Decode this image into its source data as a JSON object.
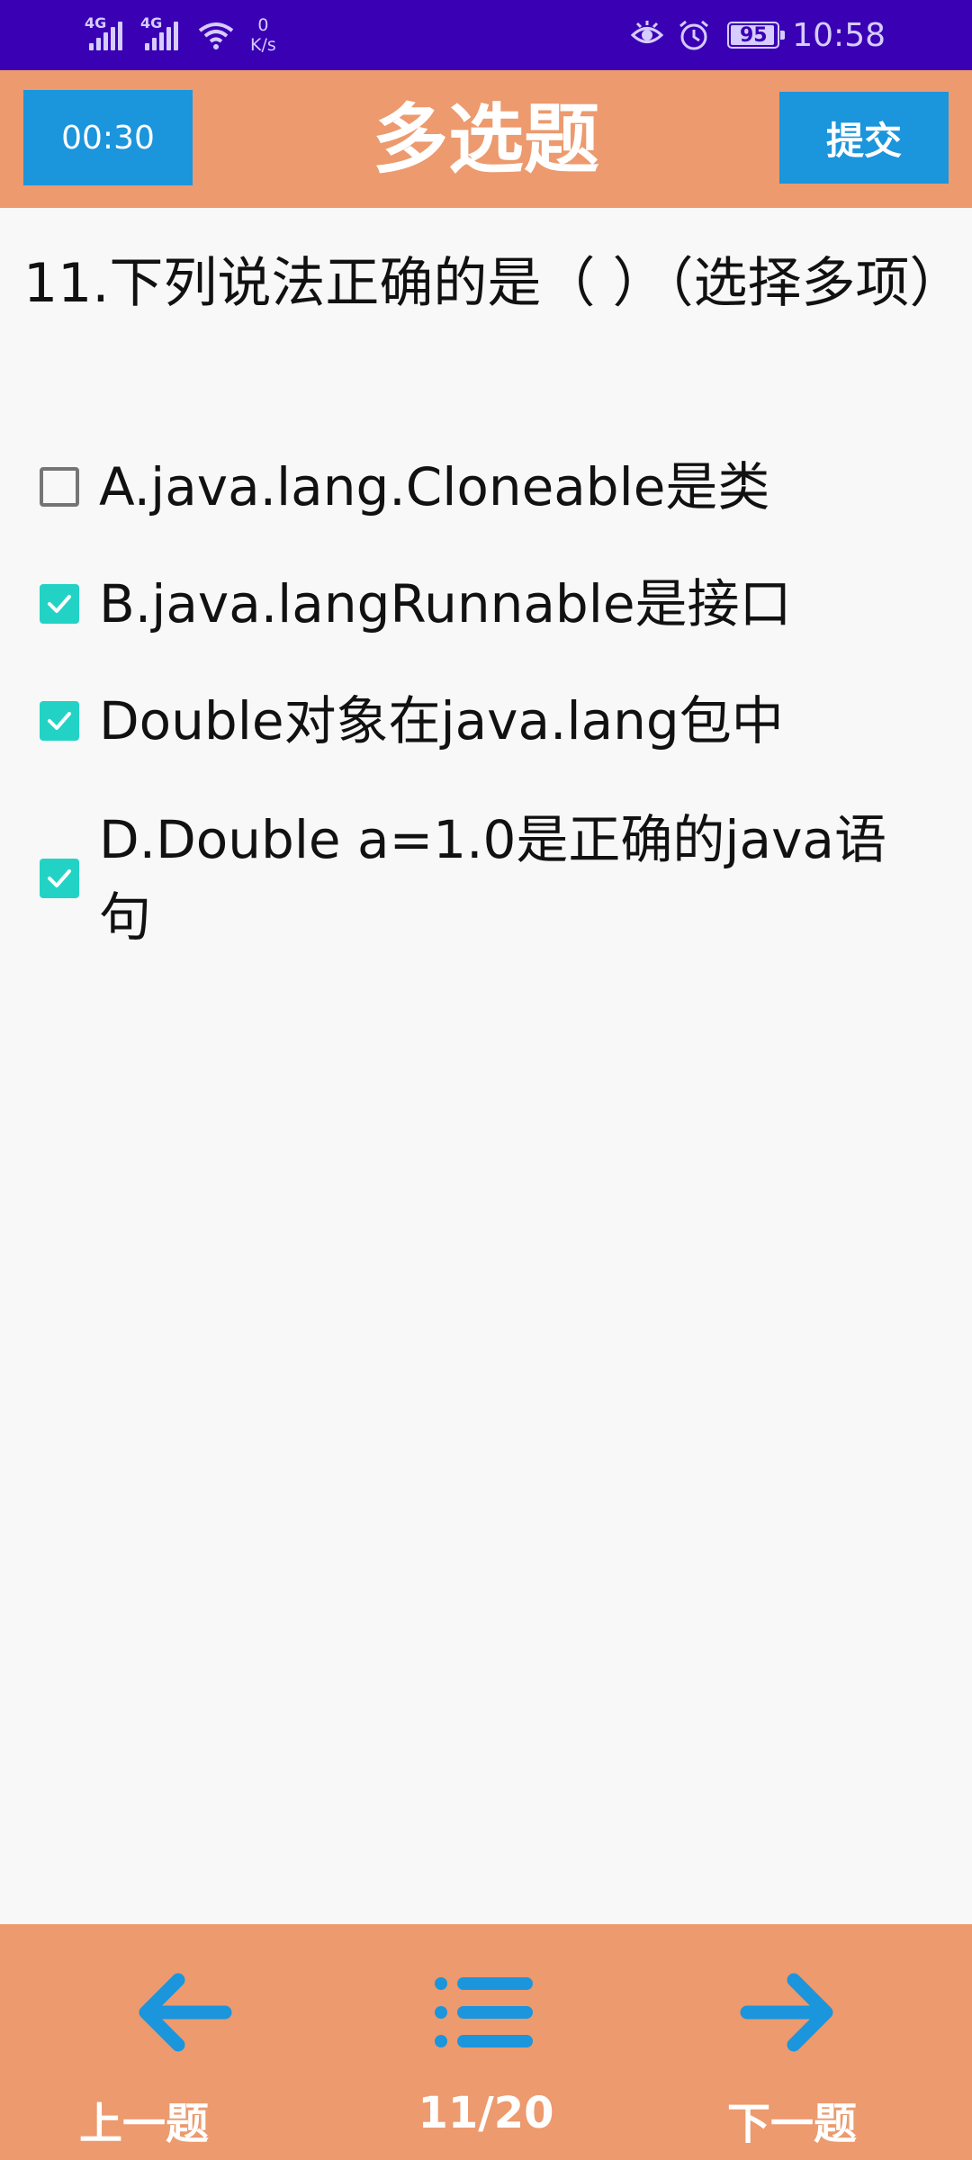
{
  "status_bar": {
    "signal_1_label": "4G",
    "signal_2_label": "4G",
    "net_speed_value": "0",
    "net_speed_unit": "K/s",
    "battery_level": "95",
    "time": "10:58"
  },
  "header": {
    "timer": "00:30",
    "title": "多选题",
    "submit_label": "提交"
  },
  "question": {
    "text": "11.下列说法正确的是（ ）（选择多项）"
  },
  "options": [
    {
      "label": "A.java.lang.Cloneable是类",
      "checked": false
    },
    {
      "label": "B.java.langRunnable是接口",
      "checked": true
    },
    {
      "label": "Double对象在java.lang包中",
      "checked": true
    },
    {
      "label": "D.Double a=1.0是正确的java语句",
      "checked": true
    }
  ],
  "footer": {
    "prev_label": "上一题",
    "progress": "11/20",
    "next_label": "下一题"
  },
  "colors": {
    "status_bar": "#3a00b4",
    "header_bg": "#ec9a6e",
    "button_bg": "#1b95dc",
    "checkbox_checked": "#22d3c5",
    "icon_blue": "#1b95dc"
  }
}
